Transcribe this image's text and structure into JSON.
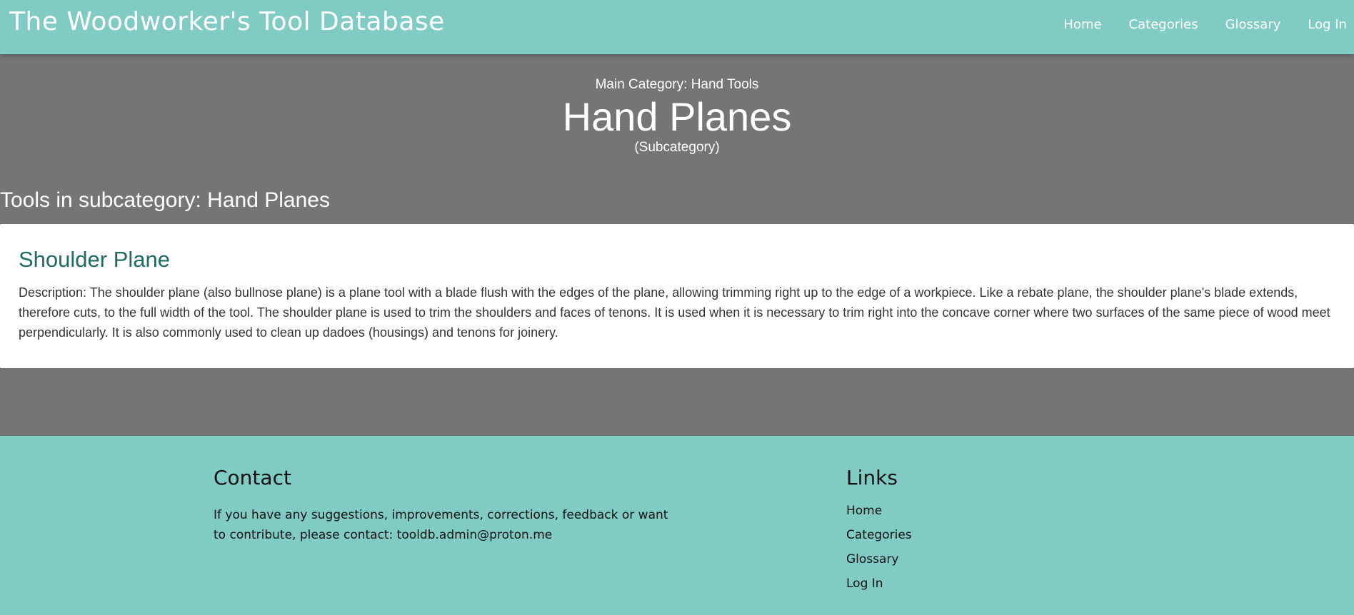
{
  "navbar": {
    "brand": "The Woodworker's Tool Database",
    "links": [
      "Home",
      "Categories",
      "Glossary",
      "Log In"
    ]
  },
  "hero": {
    "main_category": "Main Category: Hand Tools",
    "title": "Hand Planes",
    "subtitle": "(Subcategory)"
  },
  "section": {
    "heading": "Tools in subcategory: Hand Planes"
  },
  "tools": [
    {
      "name": "Shoulder Plane",
      "description": "Description: The shoulder plane (also bullnose plane) is a plane tool with a blade flush with the edges of the plane, allowing trimming right up to the edge of a workpiece. Like a rebate plane, the shoulder plane's blade extends, therefore cuts, to the full width of the tool. The shoulder plane is used to trim the shoulders and faces of tenons. It is used when it is necessary to trim right into the concave corner where two surfaces of the same piece of wood meet perpendicularly. It is also commonly used to clean up dadoes (housings) and tenons for joinery."
    }
  ],
  "footer": {
    "contact_heading": "Contact",
    "contact_text": "If you have any suggestions, improvements, corrections, feedback or want to contribute, please contact: tooldb.admin@proton.me",
    "links_heading": "Links",
    "links": [
      "Home",
      "Categories",
      "Glossary",
      "Log In"
    ]
  },
  "colors": {
    "accent": "#80cbc4",
    "background": "#757575",
    "tool_title": "#1e6b66"
  }
}
